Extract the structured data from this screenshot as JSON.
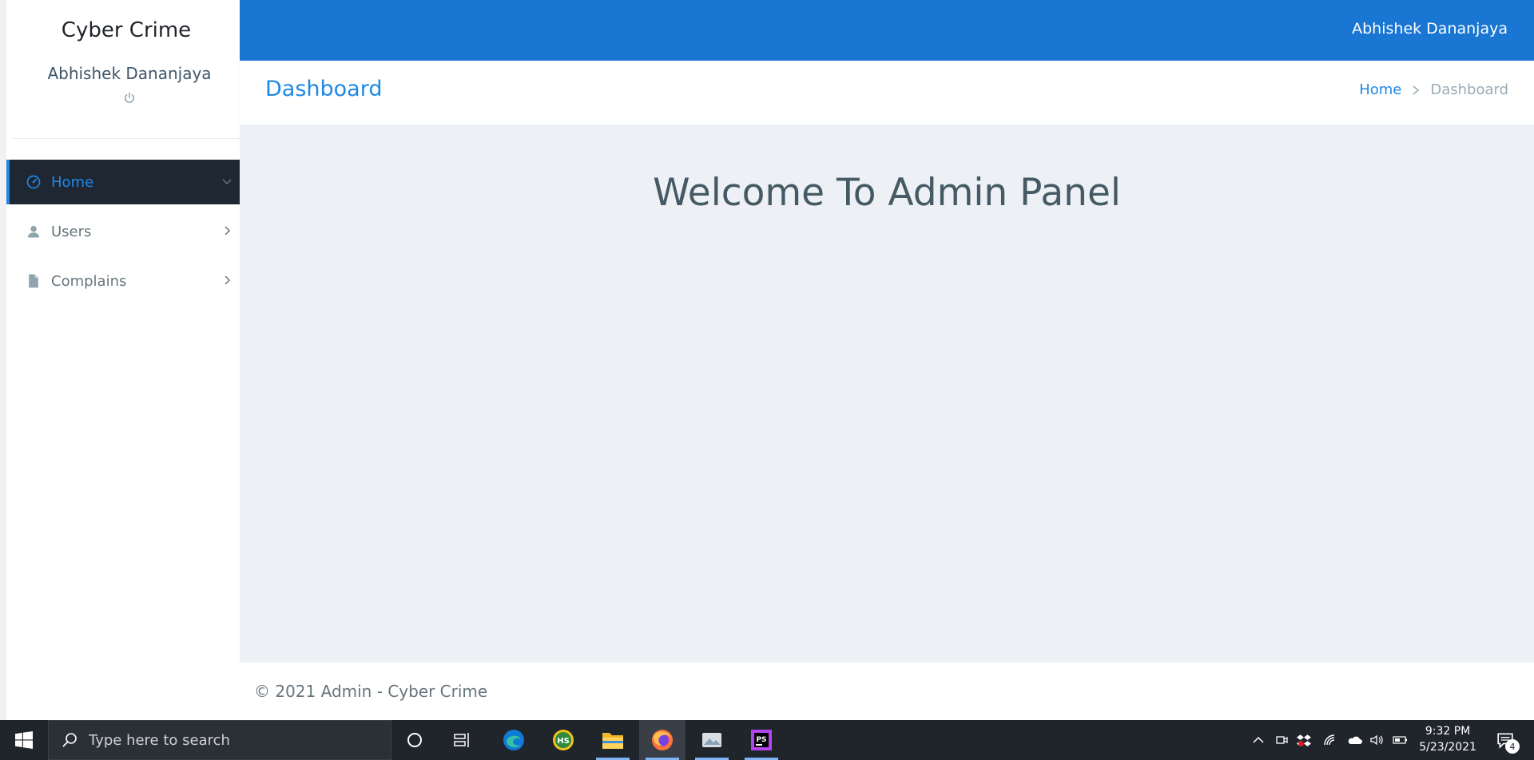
{
  "app": {
    "brand": "Cyber Crime",
    "top_user": "Abhishek Dananjaya"
  },
  "sidebar": {
    "profile_name": "Abhishek Dananjaya",
    "items": [
      {
        "label": "Home",
        "icon": "gauge-icon",
        "active": true,
        "expand": "chevron-down"
      },
      {
        "label": "Users",
        "icon": "user-icon",
        "active": false,
        "expand": "chevron-right"
      },
      {
        "label": "Complains",
        "icon": "document-icon",
        "active": false,
        "expand": "chevron-right"
      }
    ]
  },
  "page": {
    "title": "Dashboard",
    "breadcrumb": {
      "home": "Home",
      "current": "Dashboard"
    },
    "welcome": "Welcome To Admin Panel"
  },
  "footer": {
    "text": "© 2021 Admin - Cyber Crime"
  },
  "taskbar": {
    "search_placeholder": "Type here to search",
    "apps": [
      "cortana-icon",
      "task-view-icon",
      "edge-icon",
      "hs-app-icon",
      "file-explorer-icon",
      "firefox-icon",
      "photos-icon",
      "phpstorm-icon"
    ],
    "time": "9:32 PM",
    "date": "5/23/2021",
    "notification_count": "4"
  },
  "colors": {
    "topbar": "#1976d2",
    "accent": "#1e88e5",
    "sidebar_active": "#1f2733",
    "content_bg": "#edf1f5",
    "taskbar": "#20242b"
  }
}
